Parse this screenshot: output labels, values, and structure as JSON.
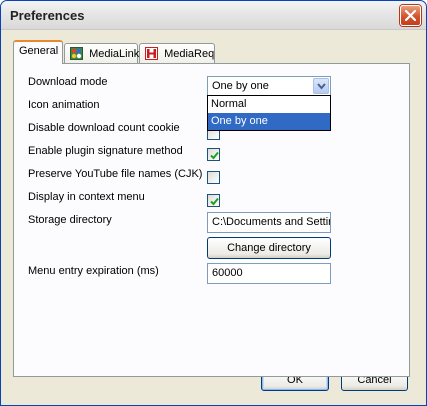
{
  "window": {
    "title": "Preferences"
  },
  "tabs": [
    {
      "label": "General",
      "icon": "none"
    },
    {
      "label": "MediaLink",
      "icon": "medialink-icon"
    },
    {
      "label": "MediaReq",
      "icon": "mediareq-icon"
    }
  ],
  "general": {
    "download_mode": {
      "label": "Download mode",
      "value": "One by one",
      "options": [
        "Normal",
        "One by one"
      ],
      "selected_option": "One by one"
    },
    "icon_animation": {
      "label": "Icon animation"
    },
    "disable_count_cookie": {
      "label": "Disable download count cookie",
      "checked": false
    },
    "plugin_signature": {
      "label": "Enable plugin signature method",
      "checked": true
    },
    "youtube_names": {
      "label": "Preserve YouTube file names (CJK)",
      "checked": false
    },
    "context_menu": {
      "label": "Display in context menu",
      "checked": true
    },
    "storage_directory": {
      "label": "Storage directory",
      "value": "C:\\Documents and Settir",
      "change_label": "Change directory"
    },
    "menu_expiration": {
      "label": "Menu entry expiration (ms)",
      "value": "60000"
    }
  },
  "footer": {
    "ok_label": "OK",
    "cancel_label": "Cancel"
  },
  "colors": {
    "accent": "#316ac5",
    "check": "#21a121",
    "close": "#d4532f"
  }
}
